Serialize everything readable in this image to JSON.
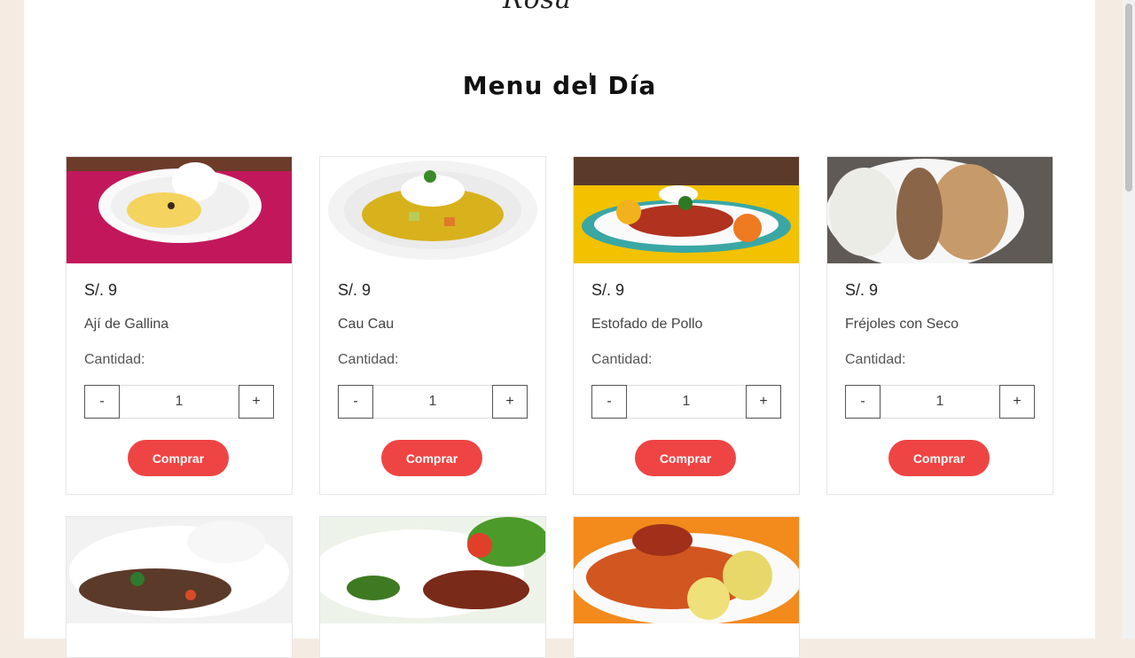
{
  "header": {
    "logo_fragment": "Rosa",
    "title": "Menu del Día"
  },
  "colors": {
    "accent": "#ef4444",
    "page_bg": "#f4ece3"
  },
  "menu": [
    {
      "price": "S/. 9",
      "name": "Ají de Gallina",
      "qty_label": "Cantidad:",
      "qty": "1",
      "minus": "-",
      "plus": "+",
      "buy": "Comprar"
    },
    {
      "price": "S/. 9",
      "name": "Cau Cau",
      "qty_label": "Cantidad:",
      "qty": "1",
      "minus": "-",
      "plus": "+",
      "buy": "Comprar"
    },
    {
      "price": "S/. 9",
      "name": "Estofado de Pollo",
      "qty_label": "Cantidad:",
      "qty": "1",
      "minus": "-",
      "plus": "+",
      "buy": "Comprar"
    },
    {
      "price": "S/. 9",
      "name": "Fréjoles con Seco",
      "qty_label": "Cantidad:",
      "qty": "1",
      "minus": "-",
      "plus": "+",
      "buy": "Comprar"
    }
  ]
}
